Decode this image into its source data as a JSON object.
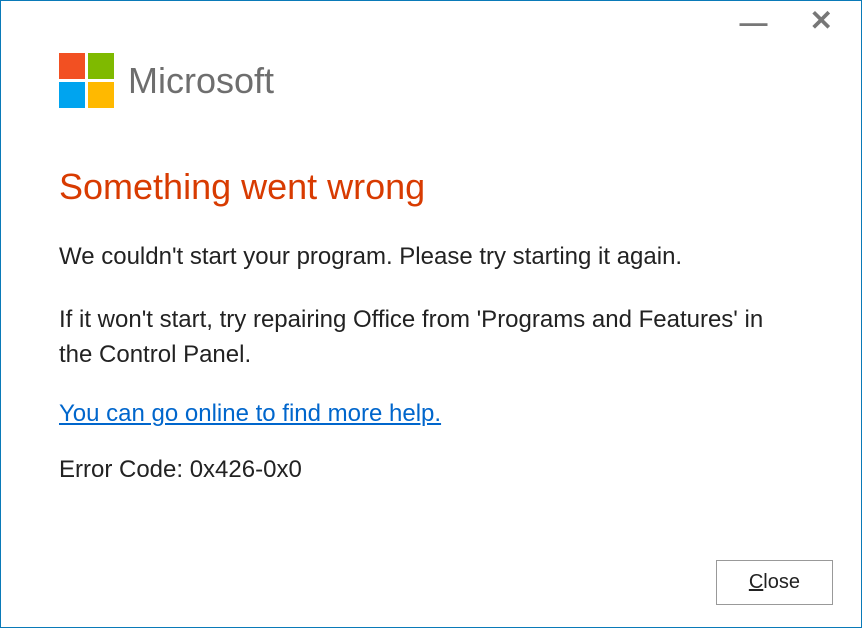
{
  "brand": "Microsoft",
  "titlebar": {
    "minimize_glyph": "—",
    "close_glyph": "✕"
  },
  "heading": "Something went wrong",
  "body": {
    "line1": "We couldn't start your program. Please try starting it again.",
    "line2": "If it won't start, try repairing Office from 'Programs and Features' in the Control Panel."
  },
  "help_link": "You can go online to find more help.",
  "error_code": "Error Code: 0x426-0x0",
  "close_button": {
    "accel": "C",
    "rest": "lose"
  },
  "colors": {
    "accent_heading": "#d83b01",
    "link": "#0066cc",
    "logo": [
      "#f25022",
      "#7fba00",
      "#00a4ef",
      "#ffb900"
    ]
  }
}
